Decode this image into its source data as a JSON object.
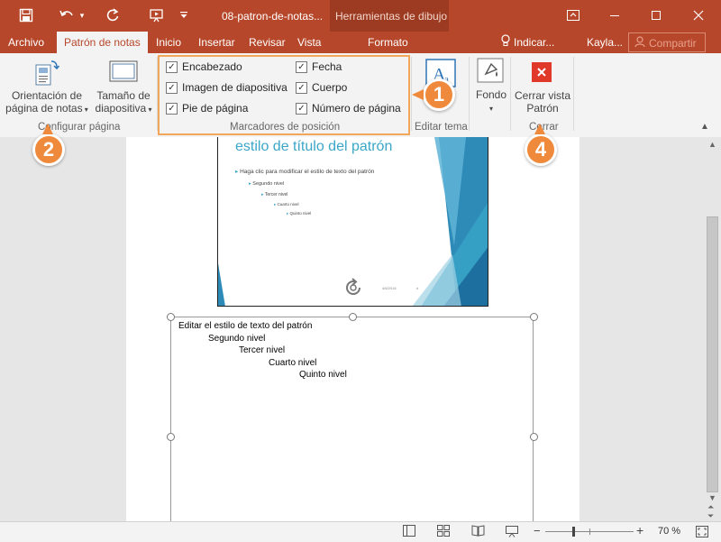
{
  "title_bar": {
    "doc_title": "08-patron-de-notas...",
    "context_label": "Herramientas de dibujo",
    "icons": [
      "save-icon",
      "undo-icon",
      "dropdown-icon",
      "redo-icon",
      "start-presentation-icon",
      "customize-qat-icon"
    ],
    "window_controls": [
      "ribbon-display-icon",
      "minimize-icon",
      "maximize-icon",
      "close-icon"
    ]
  },
  "tabs": {
    "file": "Archivo",
    "notes_master": "Patrón de notas",
    "home": "Inicio",
    "insert": "Insertar",
    "review": "Revisar",
    "view": "Vista",
    "format": "Formato",
    "tell_me": "Indicar...",
    "user": "Kayla...",
    "share": "Compartir"
  },
  "ribbon": {
    "page_setup": {
      "orientation_line1": "Orientación de",
      "orientation_line2": "página de notas",
      "size_line1": "Tamaño de",
      "size_line2": "diapositiva",
      "group_label": "Configurar página"
    },
    "placeholders": {
      "group_label": "Marcadores de posición",
      "items": [
        {
          "label": "Encabezado",
          "checked": true
        },
        {
          "label": "Imagen de diapositiva",
          "checked": true
        },
        {
          "label": "Pie de página",
          "checked": true
        },
        {
          "label": "Fecha",
          "checked": true
        },
        {
          "label": "Cuerpo",
          "checked": true
        },
        {
          "label": "Número de página",
          "checked": true
        }
      ]
    },
    "edit_theme": {
      "group_label": "Editar tema"
    },
    "background": {
      "label": "Fondo"
    },
    "close": {
      "line1": "Cerrar vista",
      "line2": "Patrón",
      "group_label": "Cerrar"
    }
  },
  "callouts": [
    "1",
    "2",
    "4"
  ],
  "slide": {
    "title_partial": "estilo de título del patrón",
    "bullets": [
      "Haga clic para modificar el estilo de texto del patrón",
      "Segundo nivel",
      "Tercer nivel",
      "Cuarto nivel",
      "Quinto nivel"
    ],
    "footer_date": "4/6/2016",
    "footer_num": "#"
  },
  "notes": {
    "levels": [
      "Editar el estilo de texto del patrón",
      "Segundo nivel",
      "Tercer nivel",
      "Cuarto nivel",
      "Quinto nivel"
    ]
  },
  "status": {
    "zoom": "70 %",
    "icons": [
      "normal-view-icon",
      "slide-sorter-icon",
      "reading-view-icon",
      "slideshow-icon",
      "zoom-out-icon",
      "zoom-in-icon",
      "fit-window-icon"
    ]
  },
  "colors": {
    "accent": "#b7472a",
    "context": "#9c3b22",
    "callout": "#ef8a3c",
    "slide_title": "#3aa6c8",
    "slide_teal": "#2e8bb8"
  }
}
